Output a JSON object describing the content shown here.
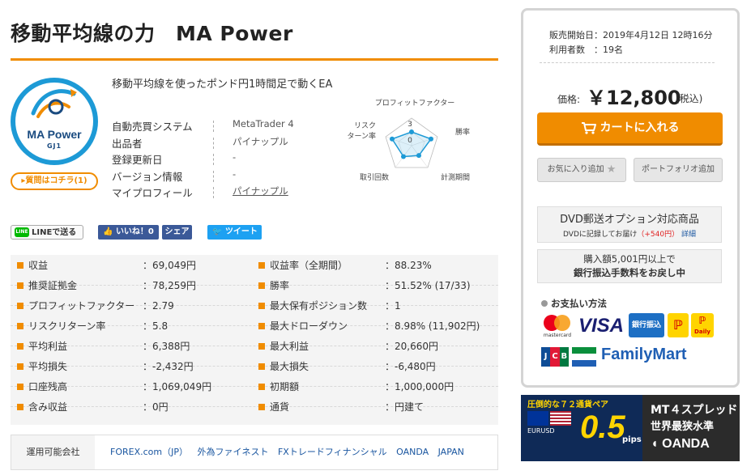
{
  "product": {
    "title": "移動平均線の力　MA Power",
    "description": "移動平均線を使ったポンド円1時間足で動くEA",
    "logo_text": "MA Power",
    "logo_sub": "GJ1",
    "question_button": "質問はコチラ(1)"
  },
  "info": [
    {
      "label": "自動売買システム",
      "value": "MetaTrader 4"
    },
    {
      "label": "出品者",
      "value": "パイナップル"
    },
    {
      "label": "登録更新日",
      "value": "-"
    },
    {
      "label": "バージョン情報",
      "value": "-"
    },
    {
      "label": "マイプロフィール",
      "value": "パイナップル"
    }
  ],
  "radar": {
    "labels": {
      "top": "プロフィットファクター",
      "right": "勝率",
      "bottom_right": "計測期間",
      "bottom_left": "取引回数",
      "left_line1": "リスク",
      "left_line2": "ターン率"
    },
    "scale_max": "3",
    "scale_min": "0",
    "values": {
      "top": 0.5,
      "right": 0.75,
      "bottom_right": 0.45,
      "bottom_left": 0.5,
      "left": 0.75
    }
  },
  "share": {
    "line": "LINEで送る",
    "line_badge": "LINE",
    "fb_like": "いいね！0",
    "fb_share": "シェア",
    "tweet": "ツイート"
  },
  "stats": [
    {
      "label": "収益",
      "value": "：69,049円"
    },
    {
      "label": "推奨証拠金",
      "value": "：78,259円"
    },
    {
      "label": "プロフィットファクター",
      "value": "：2.79"
    },
    {
      "label": "リスクリターン率",
      "value": "：5.8"
    },
    {
      "label": "平均利益",
      "value": "：6,388円"
    },
    {
      "label": "平均損失",
      "value": "：-2,432円"
    },
    {
      "label": "口座残高",
      "value": "：1,069,049円"
    },
    {
      "label": "含み収益",
      "value": "：0円"
    },
    {
      "label": "収益率（全期間）",
      "value": "：88.23%"
    },
    {
      "label": "勝率",
      "value": "：51.52% (17/33)"
    },
    {
      "label": "最大保有ポジション数",
      "value": "：1"
    },
    {
      "label": "最大ドローダウン",
      "value": "：8.98% (11,902円)"
    },
    {
      "label": "最大利益",
      "value": "：20,660円"
    },
    {
      "label": "最大損失",
      "value": "：-6,480円"
    },
    {
      "label": "初期額",
      "value": "：1,000,000円"
    },
    {
      "label": "通貨",
      "value": "：円建て"
    }
  ],
  "broker": {
    "label": "運用可能会社",
    "list": "FOREX.com（JP） 外為ファイネスト FXトレードフィナンシャル OANDA JAPAN"
  },
  "sidebar": {
    "sale_start": "販売開始日：2019年4月12日 12時16分",
    "users": "利用者数　：19名",
    "price_label": "価格:",
    "price": "￥12,800",
    "tax": "(税込)",
    "cart_button": "カートに入れる",
    "favorite_button": "お気に入り追加",
    "portfolio_button": "ポートフォリオ追加",
    "dvd_title": "DVD郵送オプション対応商品",
    "dvd_sub_a": "DVDに記録してお届け",
    "dvd_sub_b": "（+540円）",
    "dvd_sub_c": "詳細",
    "bank_line1": "購入額5,001円以上で",
    "bank_line2": "銀行振込手数料をお戻し中",
    "payment_title": "お支払い方法",
    "pay": {
      "mastercard": "mastercard",
      "visa": "VISA",
      "bank": "銀行振込",
      "daily": "Daily",
      "jcb": "JCB",
      "familymart": "FamilyMart"
    }
  },
  "banner": {
    "top": "圧倒的な７２通貨ペア",
    "pair": "EURUSD",
    "num": "0.5",
    "pips": "pips",
    "mt4": "MT４スプレッド",
    "world": "世界最狭水準",
    "oanda": "OANDA"
  },
  "colors": {
    "accent": "#f08c00",
    "blue": "#1d9ad6",
    "link": "#1a56a0"
  }
}
